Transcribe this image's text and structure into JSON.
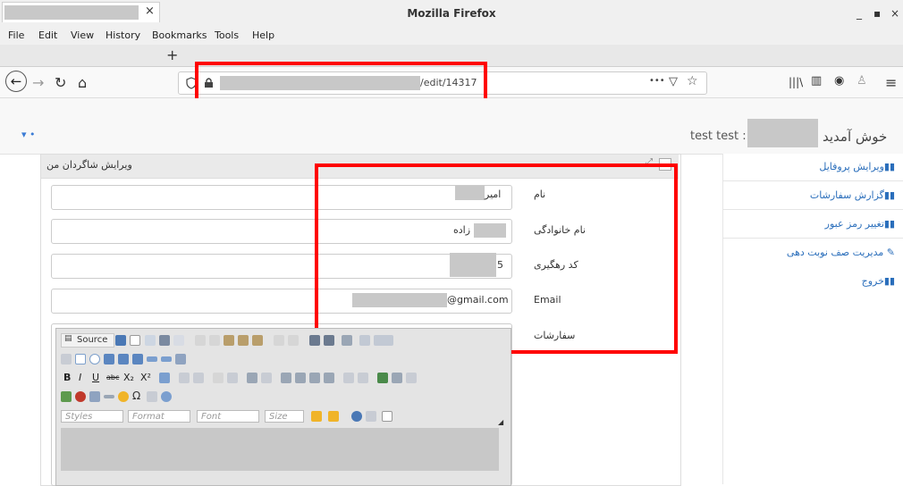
{
  "window": {
    "title": "Mozilla Firefox",
    "app_icon": "▪",
    "minimize": "_",
    "maximize": "▪",
    "close": "×"
  },
  "menu": {
    "items": [
      "File",
      "Edit",
      "View",
      "History",
      "Bookmarks",
      "Tools",
      "Help"
    ]
  },
  "tab": {
    "close": "×",
    "new_tab": "+"
  },
  "nav": {
    "back": "←",
    "forward": "→",
    "reload": "↻",
    "home": "⌂",
    "url_suffix": "/edit/14317",
    "more": "•••",
    "pocket": "▽",
    "star": "☆",
    "library": "|||\\",
    "sidebar_toggle": "▥",
    "account": "◉",
    "extension": "♙",
    "menu": "≡"
  },
  "header": {
    "welcome": "خوش آمدید",
    "user": "test test :",
    "user_icon": "▾ •"
  },
  "sidebar": {
    "items": [
      "ویرایش پروفایل",
      "گزارش سفارشات",
      "تغییر رمز عبور",
      "مدیریت صف نوبت دهی",
      "خروج"
    ]
  },
  "panel": {
    "title": "ویرایش شاگردان من"
  },
  "form": {
    "first_name_label": "نام",
    "first_name_value": "امیر",
    "last_name_label": "نام خانوادگی",
    "last_name_value": "زاده",
    "tracking_label": "کد رهگیری",
    "tracking_value": "5",
    "email_label": "Email",
    "email_value": "@gmail.com",
    "orders_label": "سفارشات"
  },
  "editor": {
    "source_label": "Source",
    "styles": "Styles",
    "format": "Format",
    "font": "Font",
    "size": "Size"
  }
}
